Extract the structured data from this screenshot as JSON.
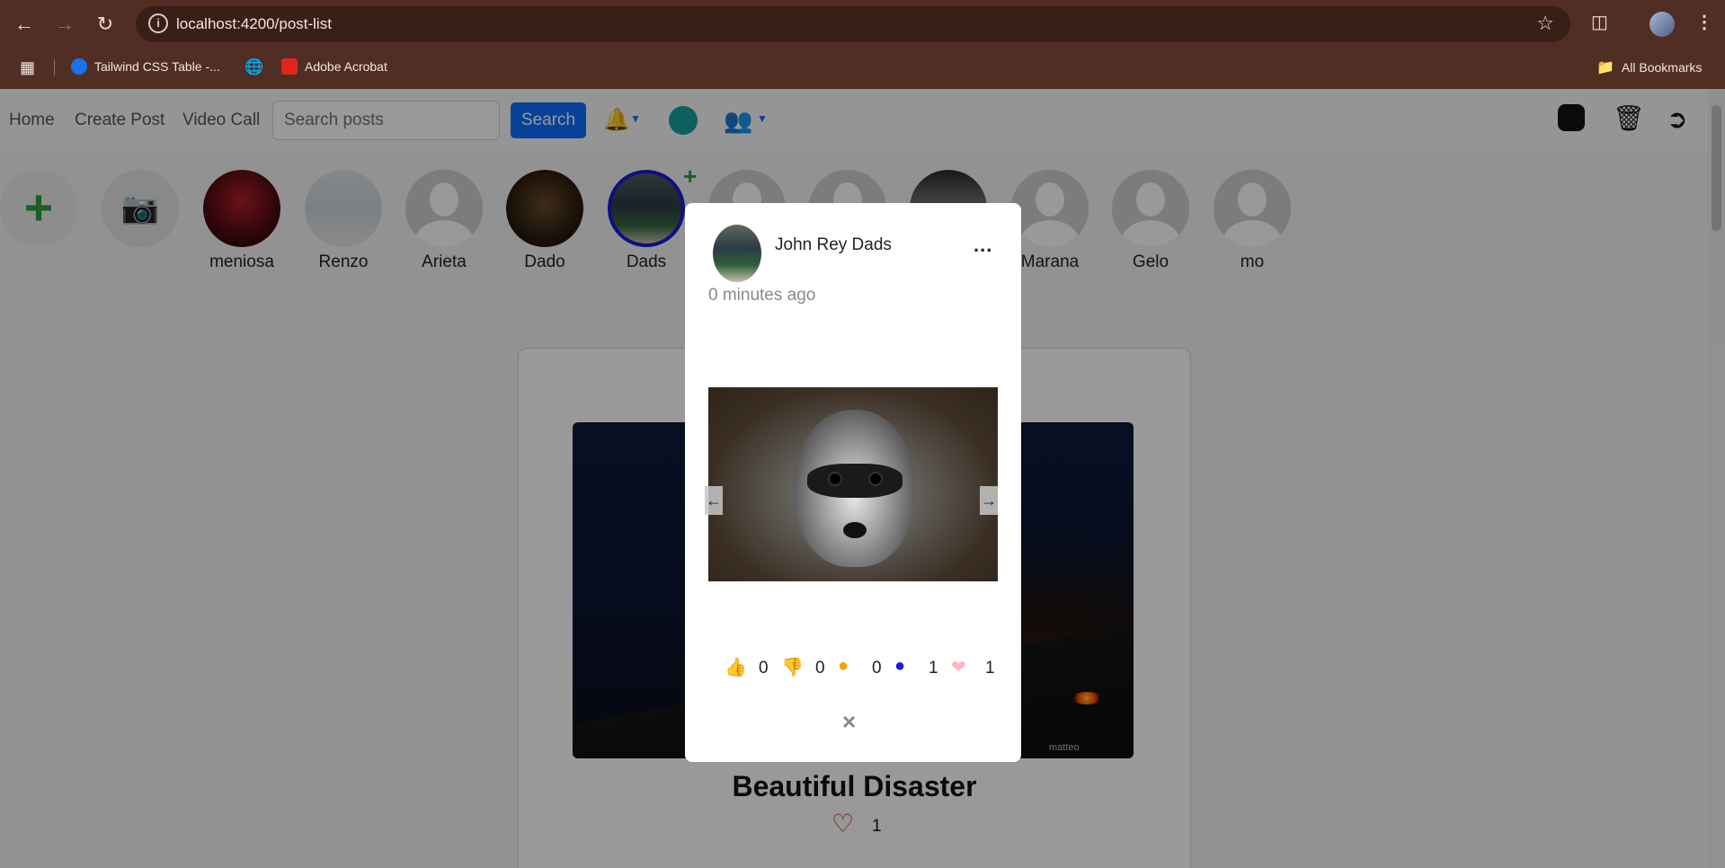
{
  "browser": {
    "url": "localhost:4200/post-list",
    "bookmarks": [
      "Tailwind CSS Table -...",
      "Adobe Acrobat"
    ],
    "all_bookmarks": "All Bookmarks"
  },
  "nav": {
    "links": [
      "Home",
      "Create Post",
      "Video Call"
    ],
    "search_placeholder": "Search posts",
    "search_button": "Search"
  },
  "stories": [
    "meniosa",
    "Renzo",
    "Arieta",
    "Dado",
    "Dads",
    "Marana",
    "Gelo",
    "mo"
  ],
  "post": {
    "title": "Beautiful Disaster",
    "likes": "1",
    "watermark": "matteo"
  },
  "modal": {
    "user": "John Rey Dads",
    "time": "0 minutes ago",
    "menu": "...",
    "reactions": {
      "like": "0",
      "dislike": "0",
      "meh": "0",
      "sad": "1",
      "love": "1"
    },
    "close": "×"
  },
  "colors": {
    "chrome": "#512e24",
    "primary": "#0d6efd",
    "story_add": "#2e9e3e",
    "like": "#1f8a1f",
    "dislike": "#e02020",
    "meh": "#f0a500",
    "sad": "#1a1adb",
    "love": "#ffb6c1"
  }
}
